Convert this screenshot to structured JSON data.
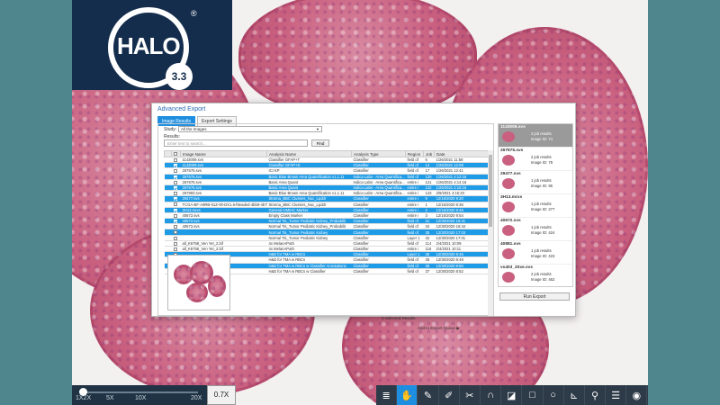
{
  "logo": {
    "name": "HALO",
    "version": "3.3",
    "mark": "®"
  },
  "dialog": {
    "title": "Advanced Export",
    "tabs": [
      "Image Results",
      "Export Settings"
    ],
    "study_label": "Study:",
    "study_value": "All the Images",
    "results_label": "Results:",
    "search_placeholder": "Enter text to search...",
    "find_button": "Find",
    "columns": [
      "",
      "Image Name",
      "Analysis Name",
      "Analysis Type",
      "Region",
      "Job",
      "Date"
    ],
    "rows": [
      {
        "checked": false,
        "selected": false,
        "image": "1143009.svs",
        "analysis": "Classifier GFAP+T",
        "type": "Classifier",
        "region": "field of",
        "job": "6",
        "date": "1/26/2021 11:58"
      },
      {
        "checked": true,
        "selected": true,
        "image": "1143009.svs",
        "analysis": "Classifier GFAP+D",
        "type": "Classifier",
        "region": "field of",
        "job": "14",
        "date": "1/26/2021 12:08"
      },
      {
        "checked": false,
        "selected": false,
        "image": "267675.svs",
        "analysis": "ICI KP",
        "type": "Classifier",
        "region": "field of",
        "job": "17",
        "date": "1/26/2021 12:41"
      },
      {
        "checked": true,
        "selected": true,
        "image": "267675.svs",
        "analysis": "Basic Blue Brown Area Quantification v1.1.11",
        "type": "Indica Labs - Area Quantifica...",
        "region": "field of",
        "job": "120",
        "date": "1/26/2021 4:12:16"
      },
      {
        "checked": false,
        "selected": false,
        "image": "267675.svs",
        "analysis": "Basic Area Quant",
        "type": "Indica Labs - Area Quantifica...",
        "region": "entire i",
        "job": "121",
        "date": "1/26/2021 4:14:16"
      },
      {
        "checked": true,
        "selected": true,
        "image": "267675.svs",
        "analysis": "Basic Area Quant",
        "type": "Indica Labs - Area Quantifica...",
        "region": "entire i",
        "job": "122",
        "date": "1/26/2021 4:16:16"
      },
      {
        "checked": false,
        "selected": false,
        "image": "267893.svs",
        "analysis": "Basic Blue Brown Area Quantification v1.1.11",
        "type": "Indica Labs - Area Quantifica...",
        "region": "entire i",
        "job": "123",
        "date": "3/9/2021 4:15:20"
      },
      {
        "checked": true,
        "selected": true,
        "image": "29477.svs",
        "analysis": "Stroma_BBC Clusters_Nuc_Lpddr",
        "type": "Classifier",
        "region": "entire i",
        "job": "9",
        "date": "12/16/2020 9:20"
      },
      {
        "checked": false,
        "selected": false,
        "image": "TCGA-BF-A9RB-01Z-00-DX1.6-f8eaded-4bb9-4b7f-8ef",
        "analysis": "Stroma_BBC Clusters_Nuc_Lpddr",
        "type": "Classifier",
        "region": "entire i",
        "job": "1",
        "date": "12/16/2020 9:36"
      },
      {
        "checked": true,
        "selected": true,
        "image": "3H13.mrxs",
        "analysis": "General HMIHC Marker",
        "type": "Classifier",
        "region": "entire i",
        "job": "2",
        "date": "12/16/2020 9:48"
      },
      {
        "checked": false,
        "selected": false,
        "image": "40672.svs",
        "analysis": "Empty Class Marker",
        "type": "Classifier",
        "region": "entire i",
        "job": "3",
        "date": "12/16/2020 9:54"
      },
      {
        "checked": true,
        "selected": true,
        "image": "40672.svs",
        "analysis": "Normal Tis_Tumor Pediatric Kidney_Probabilit",
        "type": "Classifier",
        "region": "field of",
        "job": "31",
        "date": "12/30/2020 16:41"
      },
      {
        "checked": false,
        "selected": false,
        "image": "40672.svs",
        "analysis": "Normal Tis_Tumor Pediatric Kidney_Probabilit",
        "type": "Classifier",
        "region": "field of",
        "job": "34",
        "date": "12/30/2020 16:44"
      },
      {
        "checked": false,
        "selected": true,
        "image": "",
        "analysis": "Normal Tis_Tumor Pediatric Kidney",
        "type": "Classifier",
        "region": "field of",
        "job": "35",
        "date": "12/30/2020 17:03"
      },
      {
        "checked": false,
        "selected": false,
        "image": "",
        "analysis": "Normal Tis_Tumor Pediatric Kidney",
        "type": "Classifier",
        "region": "Layer 1",
        "job": "32",
        "date": "12/30/2020 17:01"
      },
      {
        "checked": false,
        "selected": false,
        "image": "all_K6758_Ven Yet_2.bif",
        "analysis": "4x MelanAPath",
        "type": "Classifier",
        "region": "field of",
        "job": "114",
        "date": "2/4/2021 10:09"
      },
      {
        "checked": false,
        "selected": false,
        "image": "all_K6758_Ven Yet_2.bif",
        "analysis": "4x MelanAPath",
        "type": "Classifier",
        "region": "entire i",
        "job": "116",
        "date": "2/4/2021 10:11"
      },
      {
        "checked": false,
        "selected": true,
        "image": "",
        "analysis": "H&E for TMA w RBCs",
        "type": "Classifier",
        "region": "Layer 1",
        "job": "35",
        "date": "12/30/2020 8:45"
      },
      {
        "checked": false,
        "selected": false,
        "image": "",
        "analysis": "H&E for TMA w RBCs",
        "type": "Classifier",
        "region": "field of",
        "job": "36",
        "date": "12/30/2020 8:49"
      },
      {
        "checked": false,
        "selected": true,
        "image": "",
        "analysis": "H&E for TMA w RBCs w Classifier Annotations",
        "type": "Classifier",
        "region": "field of",
        "job": "36",
        "date": "12/30/2020 8:50"
      },
      {
        "checked": false,
        "selected": false,
        "image": "",
        "analysis": "H&E for TMA w RBCs w Classifier",
        "type": "Classifier",
        "region": "field of",
        "job": "37",
        "date": "12/30/2020 8:52"
      }
    ],
    "selected_results": "9 Selected Results",
    "add_to_queue": "Add to Export Queue",
    "queue": [
      {
        "name": "1143009.svs",
        "results": "2 job results",
        "image_id": "Image ID: 74"
      },
      {
        "name": "267675.svs",
        "results": "2 job results",
        "image_id": "Image ID: 78"
      },
      {
        "name": "29477.svs",
        "results": "1 job results",
        "image_id": "Image ID: 95"
      },
      {
        "name": "3H13.mrxs",
        "results": "1 job results",
        "image_id": "Image ID: 277"
      },
      {
        "name": "40672.svs",
        "results": "1 job results",
        "image_id": "Image ID: 424"
      },
      {
        "name": "40881.svs",
        "results": "1 job results",
        "image_id": "Image ID: 423"
      },
      {
        "name": "vs403_20xe.svs",
        "results": "2 job results",
        "image_id": "Image ID: 462"
      }
    ],
    "run_export": "Run Export"
  },
  "zoom": {
    "ticks": [
      "1X2X",
      "5X",
      "10X",
      "20X"
    ],
    "value": "0.7X"
  },
  "toolbar": [
    "layers-icon",
    "hand-icon",
    "brush-icon",
    "pencil-icon",
    "scissors-icon",
    "magnet-icon",
    "bucket-icon",
    "square-icon",
    "circle-icon",
    "ruler-icon",
    "pin-icon",
    "sliders-icon",
    "camera-icon"
  ]
}
